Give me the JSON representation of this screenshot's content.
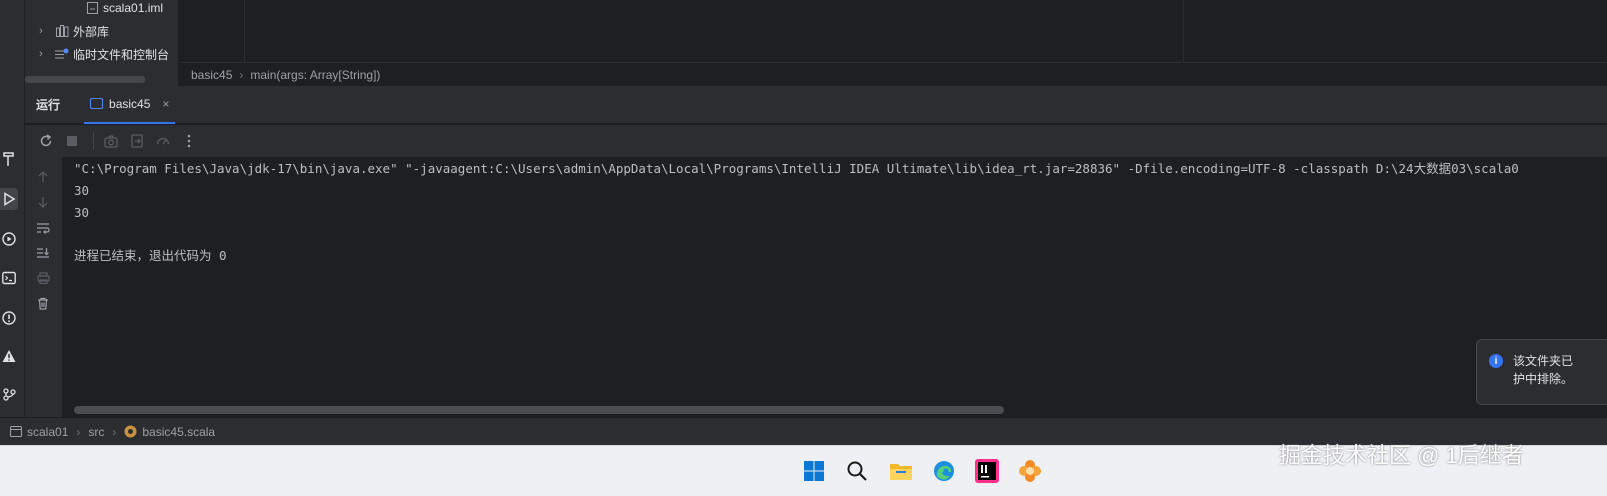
{
  "project_tree": {
    "items": [
      {
        "label": "scala01.iml",
        "expandable": false
      },
      {
        "label": "外部库",
        "expandable": true
      },
      {
        "label": "临时文件和控制台",
        "expandable": true
      }
    ]
  },
  "breadcrumb": {
    "file": "basic45",
    "method": "main(args: Array[String])"
  },
  "run_panel": {
    "title": "运行",
    "tab_label": "basic45",
    "tab_close": "×"
  },
  "console": {
    "lines": [
      "\"C:\\Program Files\\Java\\jdk-17\\bin\\java.exe\" \"-javaagent:C:\\Users\\admin\\AppData\\Local\\Programs\\IntelliJ IDEA Ultimate\\lib\\idea_rt.jar=28836\" -Dfile.encoding=UTF-8 -classpath D:\\24大数据03\\scala0",
      "30",
      "30",
      "",
      "进程已结束，退出代码为 0"
    ]
  },
  "notification": {
    "text_line1": "该文件夹已",
    "text_line2": "护中排除。"
  },
  "status_bar": {
    "project": "scala01",
    "folder": "src",
    "file": "basic45.scala"
  },
  "watermark": "掘金技术社区 @ 1后继者",
  "colors": {
    "accent": "#3574f0",
    "background": "#1e1f22",
    "panel": "#2b2d30",
    "taskbar": "#eef0f4"
  }
}
